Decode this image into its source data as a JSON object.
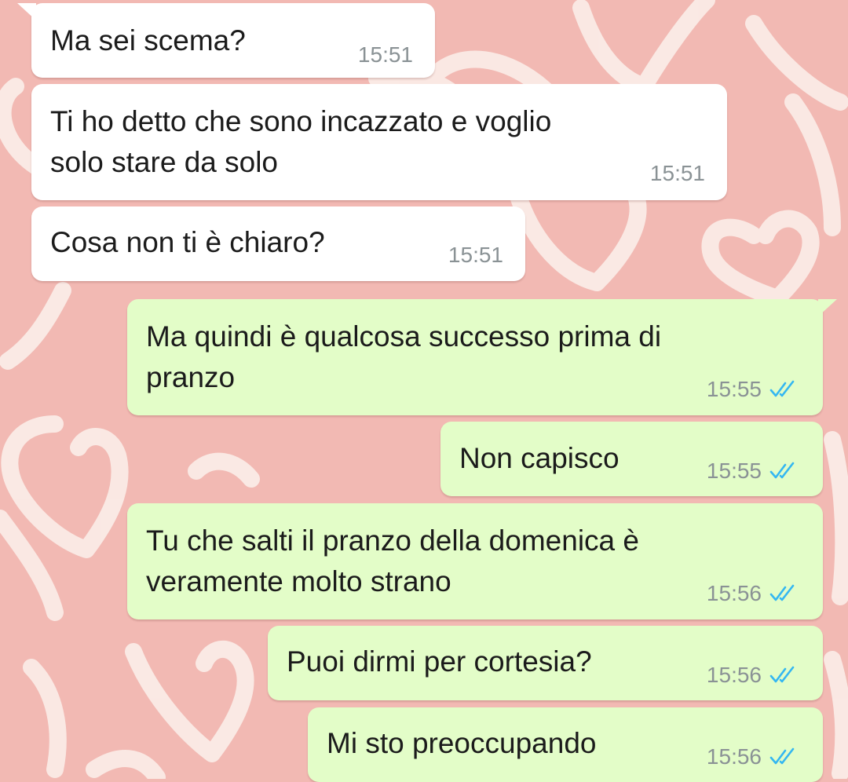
{
  "colors": {
    "background": "#f2b9b3",
    "heart_stroke": "#fbeee9",
    "incoming_bubble": "#ffffff",
    "outgoing_bubble": "#e3fdc8",
    "timestamp": "#8a9295",
    "read_ticks": "#34b7f1"
  },
  "messages": [
    {
      "direction": "incoming",
      "text": "Ma sei scema?",
      "time": "15:51"
    },
    {
      "direction": "incoming",
      "text_lines": [
        "Ti ho detto che sono incazzato e voglio",
        "solo stare da solo"
      ],
      "time": "15:51"
    },
    {
      "direction": "incoming",
      "text": "Cosa non ti è chiaro?",
      "time": "15:51"
    },
    {
      "direction": "outgoing",
      "text_lines": [
        "Ma quindi è qualcosa successo prima di",
        "pranzo"
      ],
      "time": "15:55",
      "status": "read",
      "status_icon": "double-check-icon"
    },
    {
      "direction": "outgoing",
      "text": "Non capisco",
      "time": "15:55",
      "status": "read",
      "status_icon": "double-check-icon"
    },
    {
      "direction": "outgoing",
      "text_lines": [
        "Tu che salti il pranzo della domenica è",
        "veramente molto strano"
      ],
      "time": "15:56",
      "status": "read",
      "status_icon": "double-check-icon"
    },
    {
      "direction": "outgoing",
      "text": "Puoi dirmi per cortesia?",
      "time": "15:56",
      "status": "read",
      "status_icon": "double-check-icon"
    },
    {
      "direction": "outgoing",
      "text": "Mi sto preoccupando",
      "time": "15:56",
      "status": "read",
      "status_icon": "double-check-icon"
    }
  ]
}
